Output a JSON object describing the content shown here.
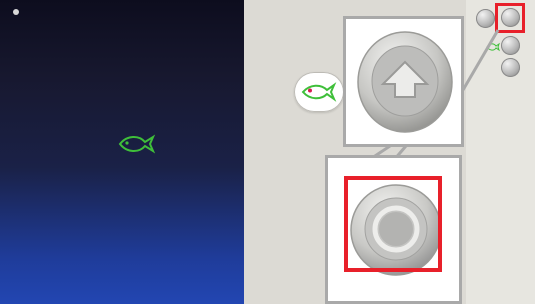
{
  "left_panel": {
    "fish_icon": "fish-icon",
    "corner_dot": "status-dot-icon"
  },
  "right_panel": {
    "fish_pill_icon": "fish-icon",
    "strip_buttons": [
      "round-button-icon",
      "round-button-icon",
      "round-button-icon",
      "round-button-icon"
    ]
  },
  "callouts": [
    {
      "icon": "up-arrow-button-icon",
      "description_color": "#a9a9a9"
    },
    {
      "icon": "round-ring-button-icon",
      "highlight_color": "#e8202a"
    }
  ],
  "colors": {
    "left_top": "#0d0d1e",
    "left_bottom": "#2246b2",
    "fish": "#3fbf3a",
    "fish_eye": "#d81b4f",
    "panel_gray": "#dcdad4",
    "highlight_red": "#e8202a"
  }
}
